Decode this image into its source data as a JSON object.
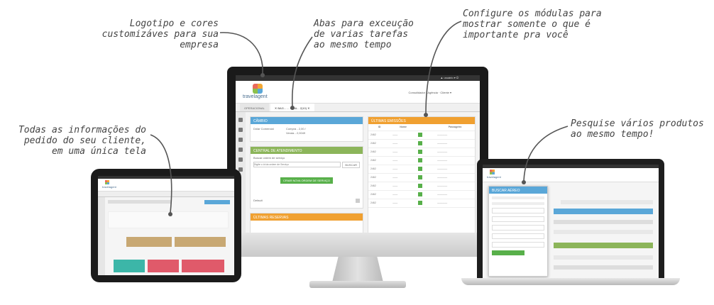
{
  "callouts": {
    "logo": "Logotipo e cores\ncustomizáves para sua\nempresa",
    "tabs": "Abas para exceução\nde varias tarefas\nao mesmo tempo",
    "modules": "Configure os módulas para\nmostrar somente o que é\nimportante pra você",
    "order_info": "Todas as informações do\npedido do seu cliente,\nem uma única tela",
    "search": "Pesquise vários produtos\nao mesmo tempo!"
  },
  "brand": {
    "logo_text": "travelagent"
  },
  "desktop": {
    "tabs": [
      "OPERACIONAL",
      "✕ BAG... ... CRIA... 2(10)   ✕"
    ],
    "panels": {
      "cambio": {
        "title": "CÂMBIO",
        "line1": "Dólar Comercial",
        "line2": "Compra - 2,00 /",
        "line3": "Venda - 2,0049"
      },
      "atendimento": {
        "title": "CENTRAL DE ATENDIMENTO",
        "label": "Buscar ordem de serviço",
        "placeholder": "Digite o id da ordem de Serviço",
        "search_btn": "BUSCAR",
        "new_btn": "CRIAR NOVA ORDEM DE SERVIÇO",
        "default": "Default"
      },
      "emissoes": {
        "title": "ÚLTIMAS EMISSÕES",
        "rows": 9
      },
      "reservas": {
        "title": "ÚLTIMAS RESERVAS"
      }
    }
  },
  "laptop": {
    "popup": {
      "title": "BUSCAR AÉREO"
    }
  },
  "colors": {
    "blue": "#5aa7d8",
    "green": "#8cb55a",
    "orange": "#f0a030",
    "red": "#e05a6a",
    "teal": "#3cb6a8"
  }
}
